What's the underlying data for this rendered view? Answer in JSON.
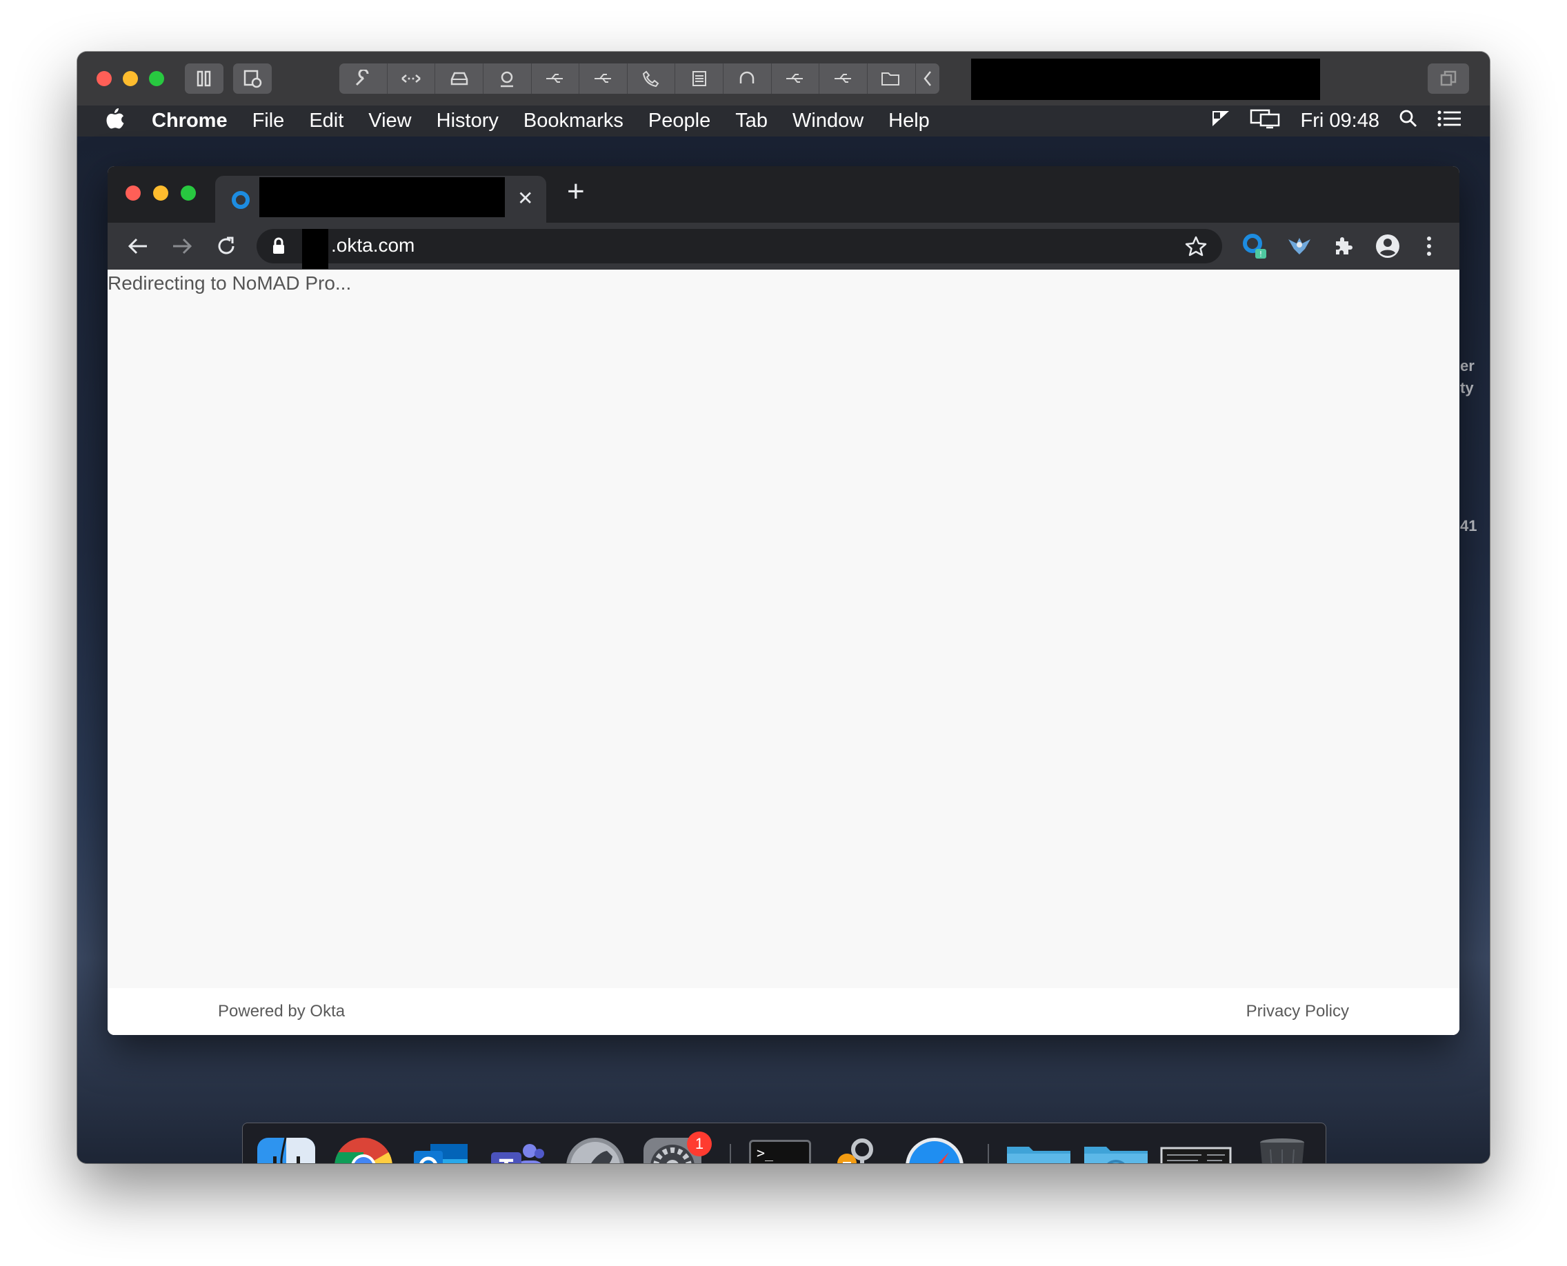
{
  "menubar": {
    "app_name": "Chrome",
    "items": [
      "File",
      "Edit",
      "View",
      "History",
      "Bookmarks",
      "People",
      "Tab",
      "Window",
      "Help"
    ],
    "clock": "Fri 09:48"
  },
  "desktop": {
    "side_text": [
      "er",
      "ty",
      "41"
    ]
  },
  "browser": {
    "url_suffix": ".okta.com",
    "new_tab_symbol": "+",
    "close_tab_symbol": "✕",
    "page_text": "Redirecting to NoMAD Pro...",
    "footer_left": "Powered by Okta",
    "footer_right": "Privacy Policy"
  },
  "dock": {
    "apps": [
      "Finder",
      "Google Chrome",
      "Microsoft Outlook",
      "Microsoft Teams",
      "Launchpad",
      "System Preferences",
      "Terminal",
      "Keychain Access",
      "Safari",
      "Applications",
      "Downloads",
      "Screen Recording",
      "Trash"
    ],
    "system_prefs_badge": "1",
    "terminal_prompt": ">_"
  },
  "colors": {
    "accent_chrome_tab": "#35363a",
    "page_background": "#f8f8f8",
    "badge_red": "#ff3b30"
  }
}
